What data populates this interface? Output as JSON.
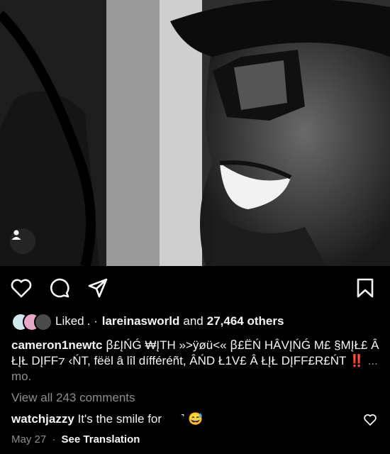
{
  "post": {
    "photo": {
      "description_icon": "user-tag-icon"
    },
    "actions": {
      "like_icon": "heart-icon",
      "comment_icon": "comment-icon",
      "share_icon": "share-icon",
      "save_icon": "bookmark-icon"
    },
    "likes": {
      "prefix": "Liked",
      "separator": ". ·",
      "user": "lareinasworld",
      "and_text": "and",
      "count": "27,464 others"
    },
    "caption": {
      "username": "cameron1newtc",
      "text": "ꞵ£ĮŃǴ ₩ĮTH »>ÿøü<« ꞵ£ËŃ HÂVĮŃǴ M£ §MĮŁ£ Â ŁĮŁ DĮFF⁊ ‹ŃT, fëël â lîl dífféréñt, ÂŃD Ł1V£ Â ŁĮŁ DĮFF£R£ŃT",
      "emoji": "‼️",
      "more": "... mo."
    },
    "view_all_comments": "View all 243 comments",
    "top_comment": {
      "username": "watchjazzy",
      "text": "It's the smile for",
      "tail": "˺",
      "emoji": "😅"
    },
    "date": "May 27",
    "dot": "·",
    "translation": "See Translation"
  }
}
